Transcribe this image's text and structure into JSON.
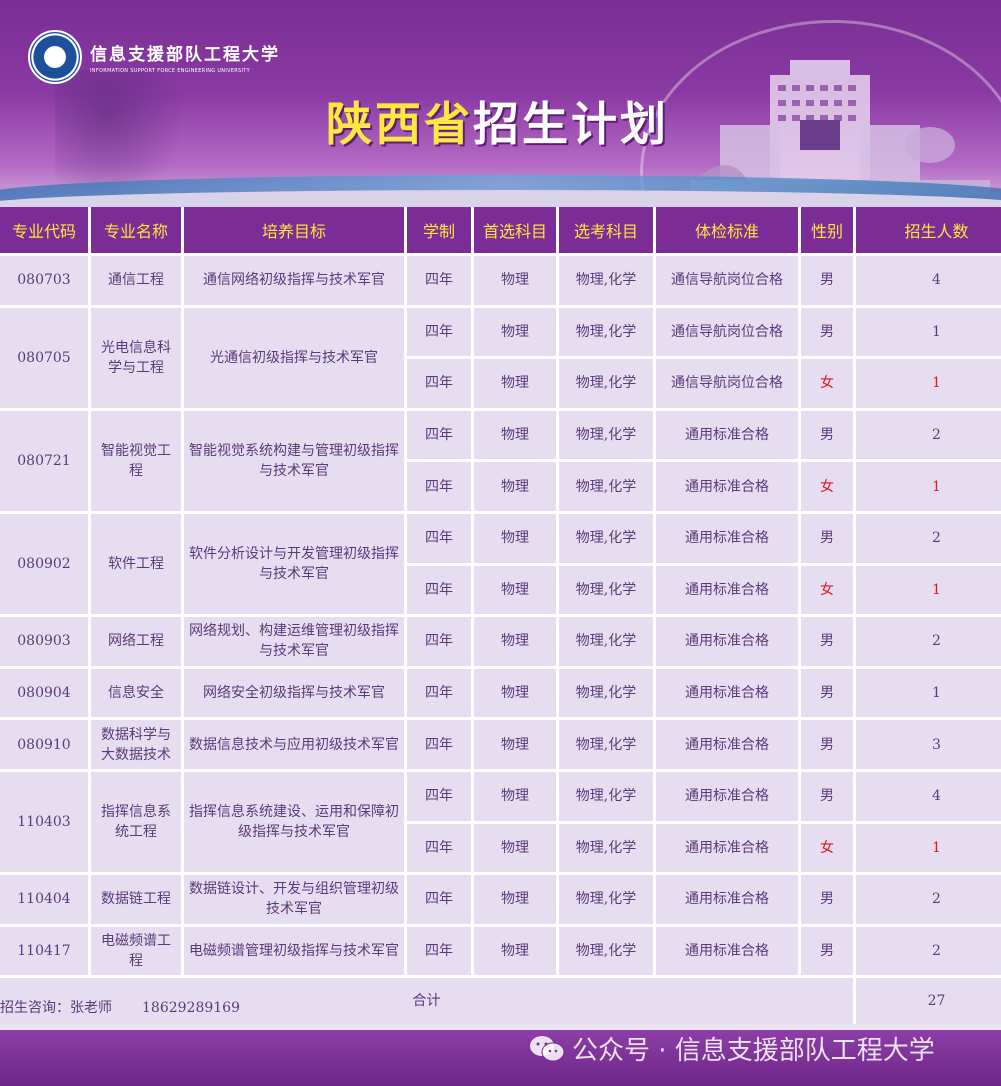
{
  "header": {
    "logo_cn": "信息支援部队工程大学",
    "logo_en": "INFORMATION SUPPORT FORCE ENGINEERING UNIVERSITY",
    "title_province": "陕西省",
    "title_rest": "招生计划"
  },
  "table": {
    "headers": [
      "专业代码",
      "专业名称",
      "培养目标",
      "学制",
      "首选科目",
      "选考科目",
      "体检标准",
      "性别",
      "招生人数"
    ],
    "rows": [
      {
        "code": "080703",
        "major": "通信工程",
        "goal": "通信网络初级指挥与技术军官",
        "years": "四年",
        "first": "物理",
        "optional": "物理,化学",
        "medical": "通信导航岗位合格",
        "gender": "男",
        "count": "4"
      },
      {
        "code": "080705",
        "major": "光电信息科学与工程",
        "goal": "光通信初级指挥与技术军官",
        "years": "四年",
        "first": "物理",
        "optional": "物理,化学",
        "medical": "通信导航岗位合格",
        "gender": "男",
        "count": "1"
      },
      {
        "years": "四年",
        "first": "物理",
        "optional": "物理,化学",
        "medical": "通信导航岗位合格",
        "gender": "女",
        "count": "1"
      },
      {
        "code": "080721",
        "major": "智能视觉工程",
        "goal": "智能视觉系统构建与管理初级指挥与技术军官",
        "years": "四年",
        "first": "物理",
        "optional": "物理,化学",
        "medical": "通用标准合格",
        "gender": "男",
        "count": "2"
      },
      {
        "years": "四年",
        "first": "物理",
        "optional": "物理,化学",
        "medical": "通用标准合格",
        "gender": "女",
        "count": "1"
      },
      {
        "code": "080902",
        "major": "软件工程",
        "goal": "软件分析设计与开发管理初级指挥与技术军官",
        "years": "四年",
        "first": "物理",
        "optional": "物理,化学",
        "medical": "通用标准合格",
        "gender": "男",
        "count": "2"
      },
      {
        "years": "四年",
        "first": "物理",
        "optional": "物理,化学",
        "medical": "通用标准合格",
        "gender": "女",
        "count": "1"
      },
      {
        "code": "080903",
        "major": "网络工程",
        "goal": "网络规划、构建运维管理初级指挥与技术军官",
        "years": "四年",
        "first": "物理",
        "optional": "物理,化学",
        "medical": "通用标准合格",
        "gender": "男",
        "count": "2"
      },
      {
        "code": "080904",
        "major": "信息安全",
        "goal": "网络安全初级指挥与技术军官",
        "years": "四年",
        "first": "物理",
        "optional": "物理,化学",
        "medical": "通用标准合格",
        "gender": "男",
        "count": "1"
      },
      {
        "code": "080910",
        "major": "数据科学与大数据技术",
        "goal": "数据信息技术与应用初级技术军官",
        "years": "四年",
        "first": "物理",
        "optional": "物理,化学",
        "medical": "通用标准合格",
        "gender": "男",
        "count": "3"
      },
      {
        "code": "110403",
        "major": "指挥信息系统工程",
        "goal": "指挥信息系统建设、运用和保障初级指挥与技术军官",
        "years": "四年",
        "first": "物理",
        "optional": "物理,化学",
        "medical": "通用标准合格",
        "gender": "男",
        "count": "4"
      },
      {
        "years": "四年",
        "first": "物理",
        "optional": "物理,化学",
        "medical": "通用标准合格",
        "gender": "女",
        "count": "1"
      },
      {
        "code": "110404",
        "major": "数据链工程",
        "goal": "数据链设计、开发与组织管理初级技术军官",
        "years": "四年",
        "first": "物理",
        "optional": "物理,化学",
        "medical": "通用标准合格",
        "gender": "男",
        "count": "2"
      },
      {
        "code": "110417",
        "major": "电磁频谱工程",
        "goal": "电磁频谱管理初级指挥与技术军官",
        "years": "四年",
        "first": "物理",
        "optional": "物理,化学",
        "medical": "通用标准合格",
        "gender": "男",
        "count": "2"
      }
    ],
    "total_label": "合计",
    "total_value": "27"
  },
  "footer": {
    "contact_label": "招生咨询：张老师",
    "contact_phone": "18629289169"
  },
  "watermark": "公众号 · 信息支援部队工程大学",
  "colors": {
    "header_bg": "#7b2c96",
    "header_text": "#ffe640",
    "cell_bg": "#e6def0",
    "cell_text": "#5a3a7a",
    "female_text": "#e0151c"
  }
}
